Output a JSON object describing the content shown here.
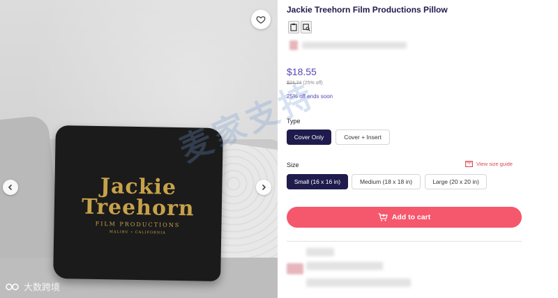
{
  "product": {
    "title": "Jackie Treehorn Film Productions Pillow",
    "price": "$18.55",
    "old_price": "$24.74",
    "discount": "(25% off)",
    "promo": "25% off ends soon"
  },
  "pillow_print": {
    "line1": "Jackie",
    "line2": "Treehorn",
    "line3": "FILM PRODUCTIONS",
    "line4": "MALIBU • CALIFORNIA"
  },
  "type_section": {
    "label": "Type",
    "options": [
      {
        "label": "Cover Only",
        "selected": true
      },
      {
        "label": "Cover + Insert",
        "selected": false
      }
    ]
  },
  "size_section": {
    "label": "Size",
    "guide_label": "View size guide",
    "options": [
      {
        "label": "Small (16 x 16 in)",
        "selected": true
      },
      {
        "label": "Medium (18 x 18 in)",
        "selected": false
      },
      {
        "label": "Large (20 x 20 in)",
        "selected": false
      }
    ]
  },
  "cart": {
    "label": "Add to cart"
  },
  "watermarks": {
    "center": "麦家支持",
    "bottom": "大数跨境"
  },
  "colors": {
    "accent_purple": "#5b44b3",
    "selected_option": "#1f1c4d",
    "cart_button": "#f5576c",
    "size_guide": "#d9454f"
  },
  "icons": [
    "heart-icon",
    "chevron-left-icon",
    "chevron-right-icon",
    "clipboard-icon",
    "image-search-icon",
    "ruler-icon",
    "cart-plus-icon"
  ]
}
